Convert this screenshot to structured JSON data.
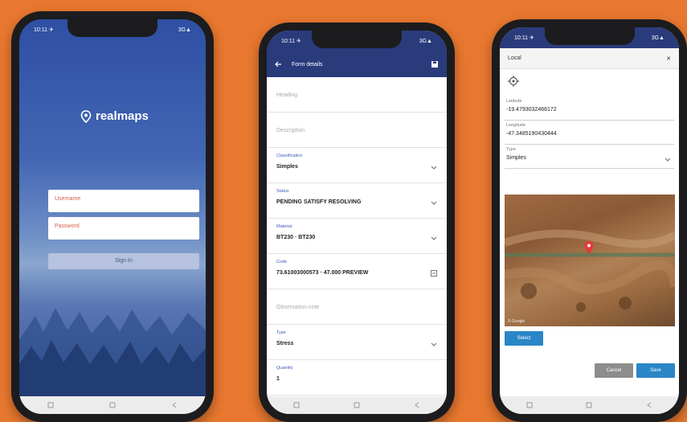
{
  "phone1": {
    "status_left": "10:11 ✈",
    "status_right": "3G▲",
    "logo_text": "realmaps",
    "username_placeholder": "Username",
    "password_placeholder": "Password",
    "login_label": "Sign In"
  },
  "phone2": {
    "status_left": "10:11 ✈",
    "status_right": "3G▲",
    "appbar_title": "Form details",
    "fields": [
      {
        "label": "",
        "placeholder": "Heading"
      },
      {
        "label": "",
        "placeholder": "Description"
      },
      {
        "label": "Classification",
        "value": "Simples",
        "dropdown": true
      },
      {
        "label": "Status",
        "value": "PENDING SATISFY RESOLVING",
        "dropdown": true
      },
      {
        "label": "Material",
        "value": "BT230 · BT230",
        "dropdown": true
      },
      {
        "label": "Code",
        "value": "73.61003000573 · 47.000 PREVIEW",
        "icon": true
      },
      {
        "label": "",
        "placeholder": "Observation note"
      },
      {
        "label": "Type",
        "value": "Stress",
        "dropdown": true
      },
      {
        "label": "Quantity",
        "value": "1"
      }
    ]
  },
  "phone3": {
    "status_left": "10:11 ✈",
    "status_right": "3G▲",
    "header_title": "Local",
    "close_glyph": "✕",
    "fields": [
      {
        "label": "Latitude",
        "value": "-19.4793032466172"
      },
      {
        "label": "Longitude",
        "value": "-47.3485190430444"
      },
      {
        "label": "Type",
        "value": "Simples"
      }
    ],
    "map_attribution": "© Google",
    "select_button": "Select",
    "cancel_button": "Cancel",
    "save_button": "Save"
  },
  "colors": {
    "background": "#e8782f",
    "appbar": "#2a3b7c",
    "accent_blue": "#2a86c7"
  }
}
